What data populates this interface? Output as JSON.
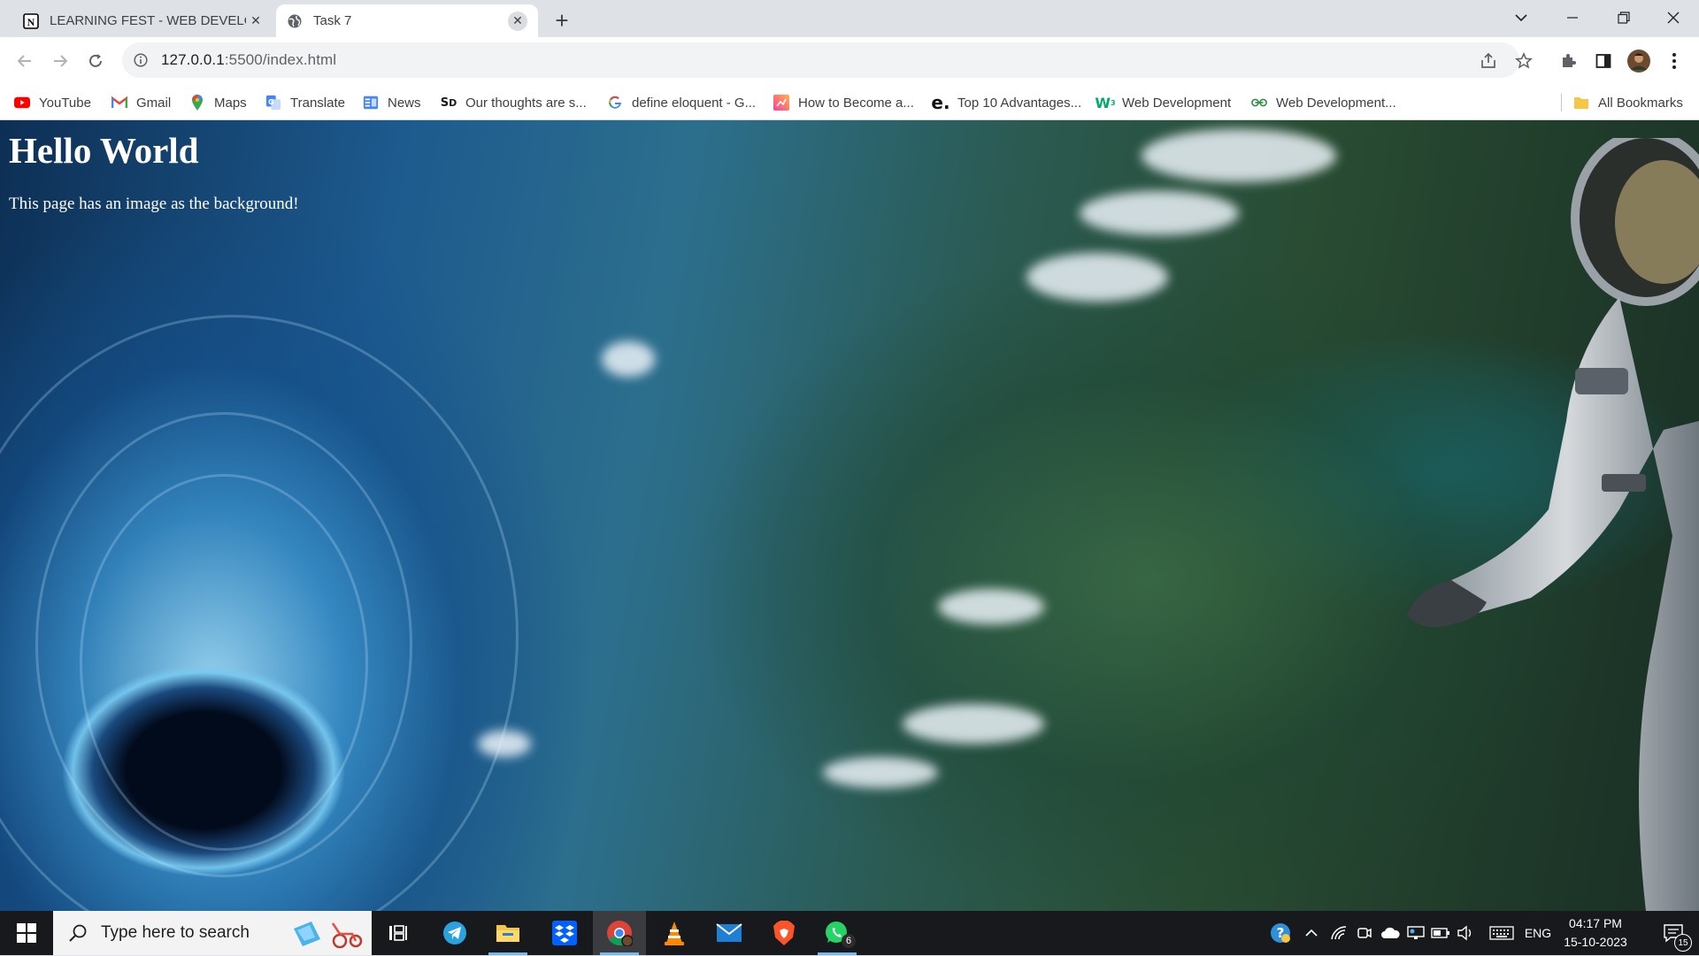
{
  "browser": {
    "tabs": [
      {
        "title": "LEARNING FEST - WEB DEVELOP",
        "active": false,
        "icon": "notion-icon"
      },
      {
        "title": "Task 7",
        "active": true,
        "icon": "globe-icon"
      }
    ],
    "address": {
      "host": "127.0.0.1",
      "rest": ":5500/index.html"
    },
    "bookmarks": [
      {
        "label": "YouTube",
        "icon": "youtube-icon"
      },
      {
        "label": "Gmail",
        "icon": "gmail-icon"
      },
      {
        "label": "Maps",
        "icon": "maps-icon"
      },
      {
        "label": "Translate",
        "icon": "translate-icon"
      },
      {
        "label": "News",
        "icon": "news-icon"
      },
      {
        "label": "Our thoughts are s...",
        "icon": "sd-icon"
      },
      {
        "label": "define eloquent - G...",
        "icon": "google-icon"
      },
      {
        "label": "How to Become a...",
        "icon": "pink-icon"
      },
      {
        "label": "Top 10 Advantages...",
        "icon": "e-icon"
      },
      {
        "label": "Web Development",
        "icon": "w3-icon"
      },
      {
        "label": "Web Development...",
        "icon": "gfg-icon"
      }
    ],
    "all_bookmarks": "All Bookmarks"
  },
  "page": {
    "heading": "Hello World",
    "text": "This page has an image as the background!"
  },
  "taskbar": {
    "search_placeholder": "Type here to search",
    "whatsapp_badge": "6",
    "language": "ENG",
    "time": "04:17 PM",
    "date": "15-10-2023",
    "notification_count": "15"
  }
}
